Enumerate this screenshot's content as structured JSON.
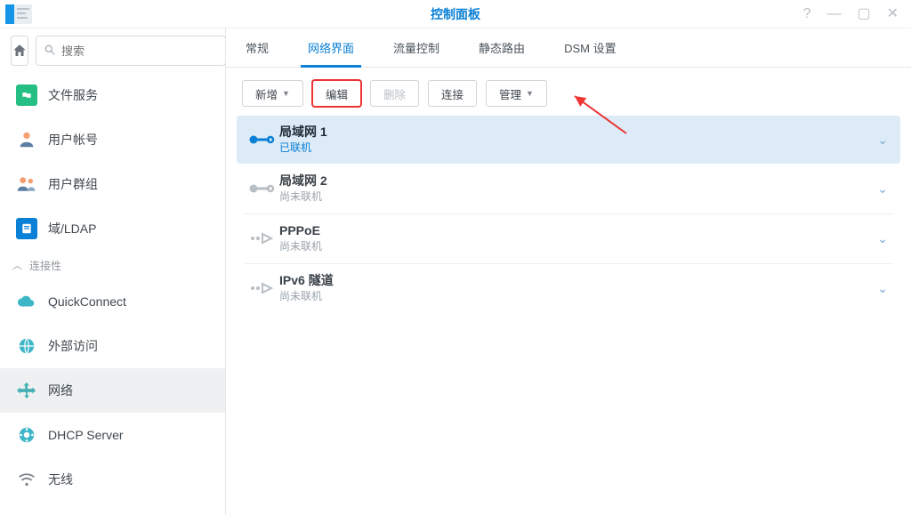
{
  "window": {
    "title": "控制面板"
  },
  "search": {
    "placeholder": "搜索"
  },
  "sidebar": {
    "section_label": "连接性",
    "items": [
      {
        "label": "文件服务",
        "icon": "file-service-icon",
        "color": "bg-green"
      },
      {
        "label": "用户帐号",
        "icon": "user-account-icon",
        "color": "bg-peach"
      },
      {
        "label": "用户群组",
        "icon": "user-group-icon",
        "color": "bg-peach"
      },
      {
        "label": "域/LDAP",
        "icon": "ldap-icon",
        "color": "bg-blue"
      }
    ],
    "conn_items": [
      {
        "label": "QuickConnect",
        "icon": "cloud-icon",
        "color": "bg-cyan"
      },
      {
        "label": "外部访问",
        "icon": "globe-icon",
        "color": "bg-cyan"
      },
      {
        "label": "网络",
        "icon": "network-icon",
        "color": "bg-teal",
        "active": true
      },
      {
        "label": "DHCP Server",
        "icon": "dhcp-icon",
        "color": "bg-cyan"
      },
      {
        "label": "无线",
        "icon": "wifi-icon",
        "color": "txt-grey"
      }
    ]
  },
  "tabs": [
    {
      "label": "常规"
    },
    {
      "label": "网络界面",
      "active": true
    },
    {
      "label": "流量控制"
    },
    {
      "label": "静态路由"
    },
    {
      "label": "DSM 设置"
    }
  ],
  "toolbar": {
    "add": "新增",
    "edit": "编辑",
    "delete": "删除",
    "connect": "连接",
    "manage": "管理"
  },
  "interfaces": [
    {
      "name": "局域网 1",
      "status": "已联机",
      "type": "lan",
      "selected": true
    },
    {
      "name": "局域网 2",
      "status": "尚未联机",
      "type": "lan",
      "selected": false
    },
    {
      "name": "PPPoE",
      "status": "尚未联机",
      "type": "pppoe",
      "selected": false
    },
    {
      "name": "IPv6 隧道",
      "status": "尚未联机",
      "type": "tunnel",
      "selected": false
    }
  ]
}
